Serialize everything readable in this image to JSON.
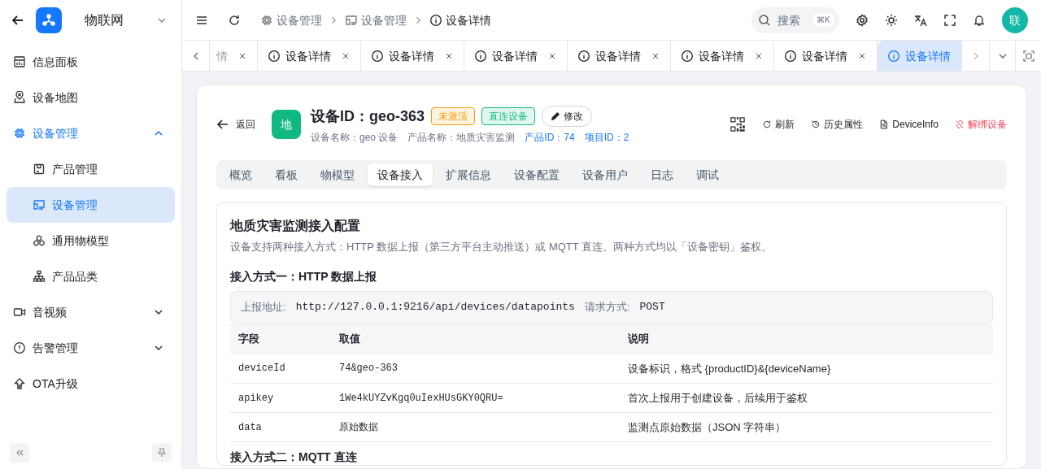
{
  "app": {
    "title": "物联网"
  },
  "sidebar": {
    "items": [
      {
        "label": "信息面板",
        "selected": false
      },
      {
        "label": "设备地图",
        "selected": false
      },
      {
        "label": "设备管理",
        "selected": false,
        "expanded": true,
        "children": [
          {
            "label": "产品管理",
            "selected": false
          },
          {
            "label": "设备管理",
            "selected": true
          },
          {
            "label": "通用物模型",
            "selected": false
          },
          {
            "label": "产品品类",
            "selected": false
          }
        ]
      },
      {
        "label": "音视频",
        "selected": false,
        "expanded": false
      },
      {
        "label": "告警管理",
        "selected": false,
        "expanded": false
      },
      {
        "label": "OTA升级",
        "selected": false
      }
    ]
  },
  "breadcrumb": [
    "设备管理",
    "设备管理",
    "设备详情"
  ],
  "search": {
    "placeholder": "搜索",
    "shortcut": "⌘K"
  },
  "avatar": "联",
  "page_tabs": [
    {
      "label": "情",
      "kind": "clipped",
      "selected": false
    },
    {
      "label": "设备详情",
      "kind": "tab",
      "selected": false
    },
    {
      "label": "设备详情",
      "kind": "tab",
      "selected": false
    },
    {
      "label": "设备详情",
      "kind": "tab",
      "selected": false
    },
    {
      "label": "设备详情",
      "kind": "tab",
      "selected": false
    },
    {
      "label": "设备详情",
      "kind": "tab",
      "selected": false
    },
    {
      "label": "设备详情",
      "kind": "tab",
      "selected": false
    },
    {
      "label": "设备详情",
      "kind": "tab",
      "selected": true
    }
  ],
  "device": {
    "back": "返回",
    "avatar": "地",
    "title": "设备ID：geo-363",
    "badges": [
      {
        "label": "未激活",
        "color": "#f59e0b"
      },
      {
        "label": "直连设备",
        "color": "#10b981"
      }
    ],
    "edit": "修改",
    "meta": [
      {
        "label": "设备名称：geo 设备",
        "highlight": false
      },
      {
        "label": "产品名称：地质灾害监测",
        "highlight": false
      },
      {
        "label": "产品ID：74",
        "highlight": true
      },
      {
        "label": "项目ID：2",
        "highlight": true
      }
    ],
    "actions": [
      {
        "label": "刷新",
        "danger": false
      },
      {
        "label": "历史属性",
        "danger": false
      },
      {
        "label": "DeviceInfo",
        "danger": false
      },
      {
        "label": "解绑设备",
        "danger": true
      }
    ]
  },
  "detail_tabs": [
    {
      "label": "概览",
      "selected": false
    },
    {
      "label": "看板",
      "selected": false
    },
    {
      "label": "物模型",
      "selected": false
    },
    {
      "label": "设备接入",
      "selected": true
    },
    {
      "label": "扩展信息",
      "selected": false
    },
    {
      "label": "设备配置",
      "selected": false
    },
    {
      "label": "设备用户",
      "selected": false
    },
    {
      "label": "日志",
      "selected": false
    },
    {
      "label": "调试",
      "selected": false
    }
  ],
  "access": {
    "title": "地质灾害监测接入配置",
    "description": "设备支持两种接入方式：HTTP 数据上报（第三方平台主动推送）或 MQTT 直连。两种方式均以「设备密钥」鉴权。",
    "method1": {
      "title": "接入方式一：HTTP 数据上报",
      "url_label": "上报地址:",
      "url": "http://127.0.0.1:9216/api/devices/datapoints",
      "method_label": "请求方式:",
      "method": "POST",
      "table": {
        "columns": [
          "字段",
          "取值",
          "说明"
        ],
        "rows": [
          [
            "deviceId",
            "74&geo-363",
            "设备标识，格式 {productID}&{deviceName}"
          ],
          [
            "apikey",
            "1We4kUYZvKgq0uIexHUsGKY0QRU=",
            "首次上报用于创建设备，后续用于鉴权"
          ],
          [
            "data",
            "原始数据",
            "监测点原始数据（JSON 字符串）"
          ]
        ]
      }
    },
    "method2": {
      "title": "接入方式二：MQTT 直连"
    }
  }
}
